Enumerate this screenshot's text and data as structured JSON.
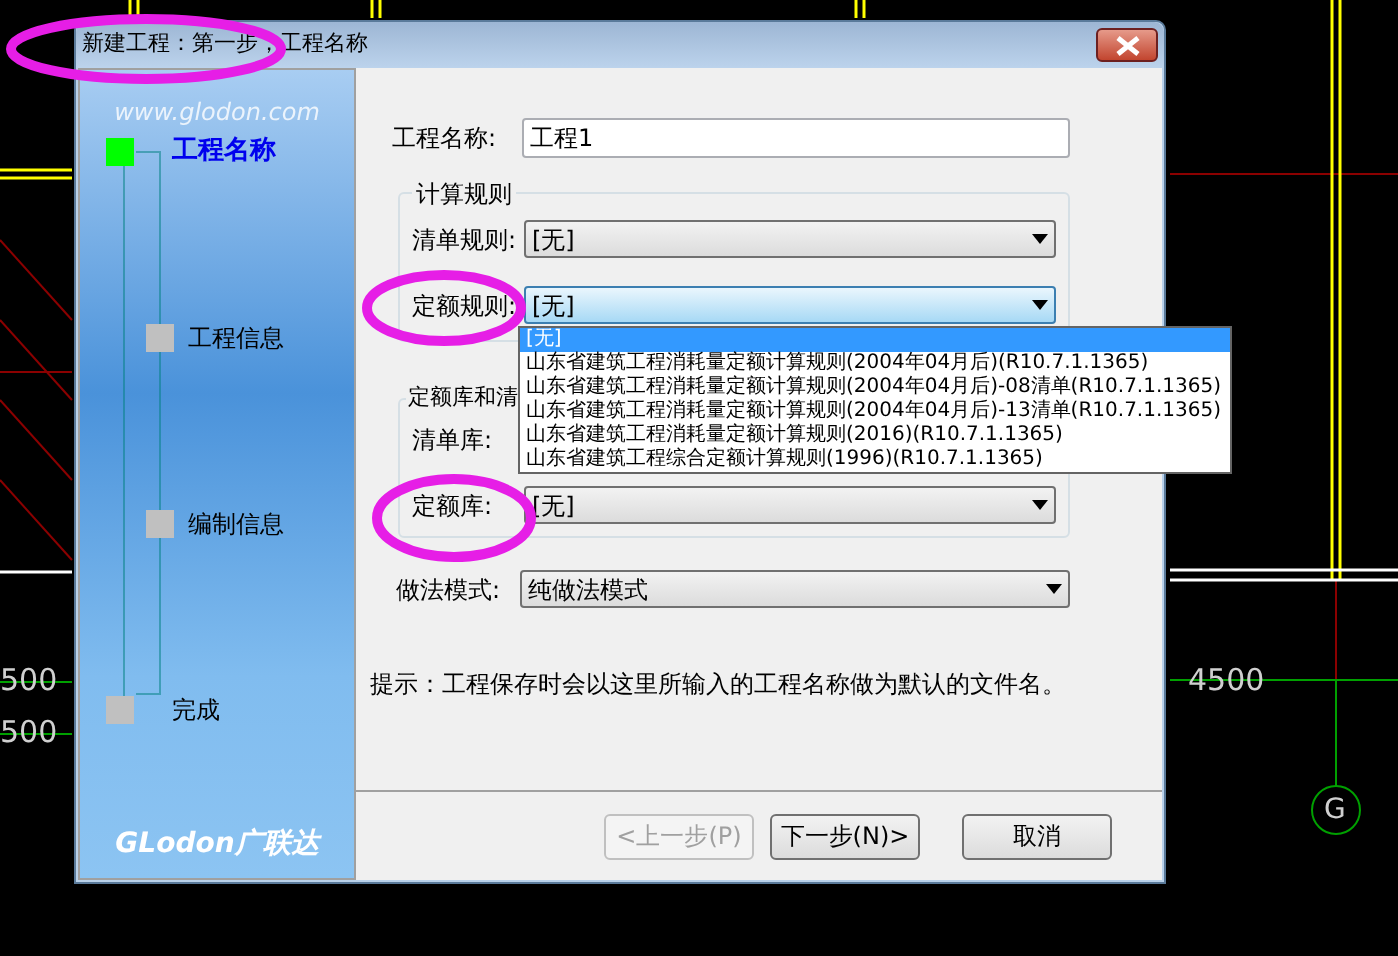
{
  "window": {
    "title": "新建工程：第一步，工程名称"
  },
  "sidebar": {
    "watermark": "www.glodon.com",
    "steps": [
      {
        "label": "工程名称",
        "selected": true,
        "children": [
          {
            "label": "工程信息",
            "selected": false
          },
          {
            "label": "编制信息",
            "selected": false
          }
        ]
      },
      {
        "label": "完成",
        "selected": false
      }
    ],
    "logo": "GLodon广联达"
  },
  "form": {
    "name_label": "工程名称:",
    "name_value": "工程1",
    "rules_group": "计算规则",
    "rules": [
      {
        "label": "清单规则:",
        "value": "[无]",
        "focused": false
      },
      {
        "label": "定额规则:",
        "value": "[无]",
        "focused": true
      }
    ],
    "library_group": "定额库和清",
    "libraries": [
      {
        "label": "清单库:"
      },
      {
        "label": "定额库:",
        "value": "[无]"
      }
    ],
    "mode_label": "做法模式:",
    "mode_value": "纯做法模式"
  },
  "dropdown_options": [
    {
      "label": "[无]",
      "selected": true
    },
    {
      "label": "山东省建筑工程消耗量定额计算规则(2004年04月后)(R10.7.1.1365)",
      "selected": false
    },
    {
      "label": "山东省建筑工程消耗量定额计算规则(2004年04月后)-08清单(R10.7.1.1365)",
      "selected": false
    },
    {
      "label": "山东省建筑工程消耗量定额计算规则(2004年04月后)-13清单(R10.7.1.1365)",
      "selected": false
    },
    {
      "label": "山东省建筑工程消耗量定额计算规则(2016)(R10.7.1.1365)",
      "selected": false
    },
    {
      "label": "山东省建筑工程综合定额计算规则(1996)(R10.7.1.1365)",
      "selected": false
    }
  ],
  "hint": "提示：工程保存时会以这里所输入的工程名称做为默认的文件名。",
  "buttons": [
    {
      "label": "<上一步(P)",
      "disabled": true
    },
    {
      "label": "下一步(N)>",
      "disabled": false
    },
    {
      "label": "取消",
      "disabled": false
    }
  ],
  "cad": {
    "left_labels": [
      "500",
      "500"
    ],
    "right_label": "4500",
    "axis": "G"
  }
}
